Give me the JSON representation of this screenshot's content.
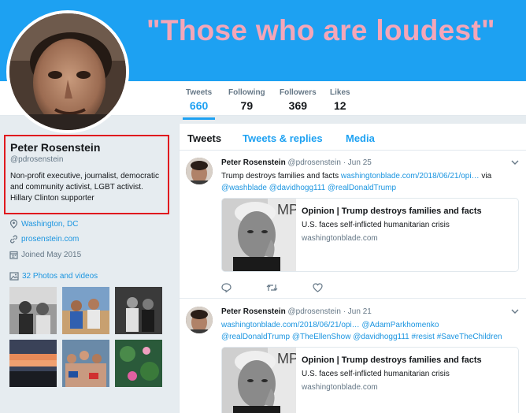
{
  "banner": {
    "quote": "\"Those who are loudest\""
  },
  "stats": [
    {
      "label": "Tweets",
      "value": "660"
    },
    {
      "label": "Following",
      "value": "79"
    },
    {
      "label": "Followers",
      "value": "369"
    },
    {
      "label": "Likes",
      "value": "12"
    }
  ],
  "profile": {
    "name": "Peter Rosenstein",
    "handle": "@pdrosenstein",
    "bio": "Non-profit executive, journalist, democratic and community activist, LGBT activist. Hillary Clinton supporter",
    "location": "Washington, DC",
    "website": "prosenstein.com",
    "joined": "Joined May 2015",
    "photos_label": "32 Photos and videos"
  },
  "tabs": [
    "Tweets",
    "Tweets & replies",
    "Media"
  ],
  "tweets": [
    {
      "name": "Peter Rosenstein",
      "handle": "@pdrosenstein",
      "date": "· Jun 25",
      "line1_text": "Trump destroys families and facts ",
      "line1_link": "washingtonblade.com/2018/06/21/opi…",
      "line1_suffix": " via",
      "line2": "@washblade @davidhogg111 @realDonaldTrump",
      "card": {
        "title": "Opinion | Trump destroys families and facts",
        "description": "U.S. faces self-inflicted humanitarian crisis",
        "domain": "washingtonblade.com"
      }
    },
    {
      "name": "Peter Rosenstein",
      "handle": "@pdrosenstein",
      "date": "· Jun 21",
      "line1_text": "",
      "line1_link": "washingtonblade.com/2018/06/21/opi… @AdamParkhomenko",
      "line1_suffix": "",
      "line2": "@realDonaldTrump @TheEllenShow @davidhogg111 #resist #SaveTheChildren",
      "card": {
        "title": "Opinion | Trump destroys families and facts",
        "description": "U.S. faces self-inflicted humanitarian crisis",
        "domain": "washingtonblade.com"
      }
    }
  ],
  "colors": {
    "banner": "#1da1f2",
    "banner_text": "#f4a6b8",
    "link": "#1b95e0",
    "highlight_box": "#e0191e"
  },
  "icons": [
    "location-pin-icon",
    "link-icon",
    "calendar-icon",
    "photo-icon",
    "chevron-down-icon",
    "reply-icon",
    "retweet-icon",
    "like-icon"
  ]
}
